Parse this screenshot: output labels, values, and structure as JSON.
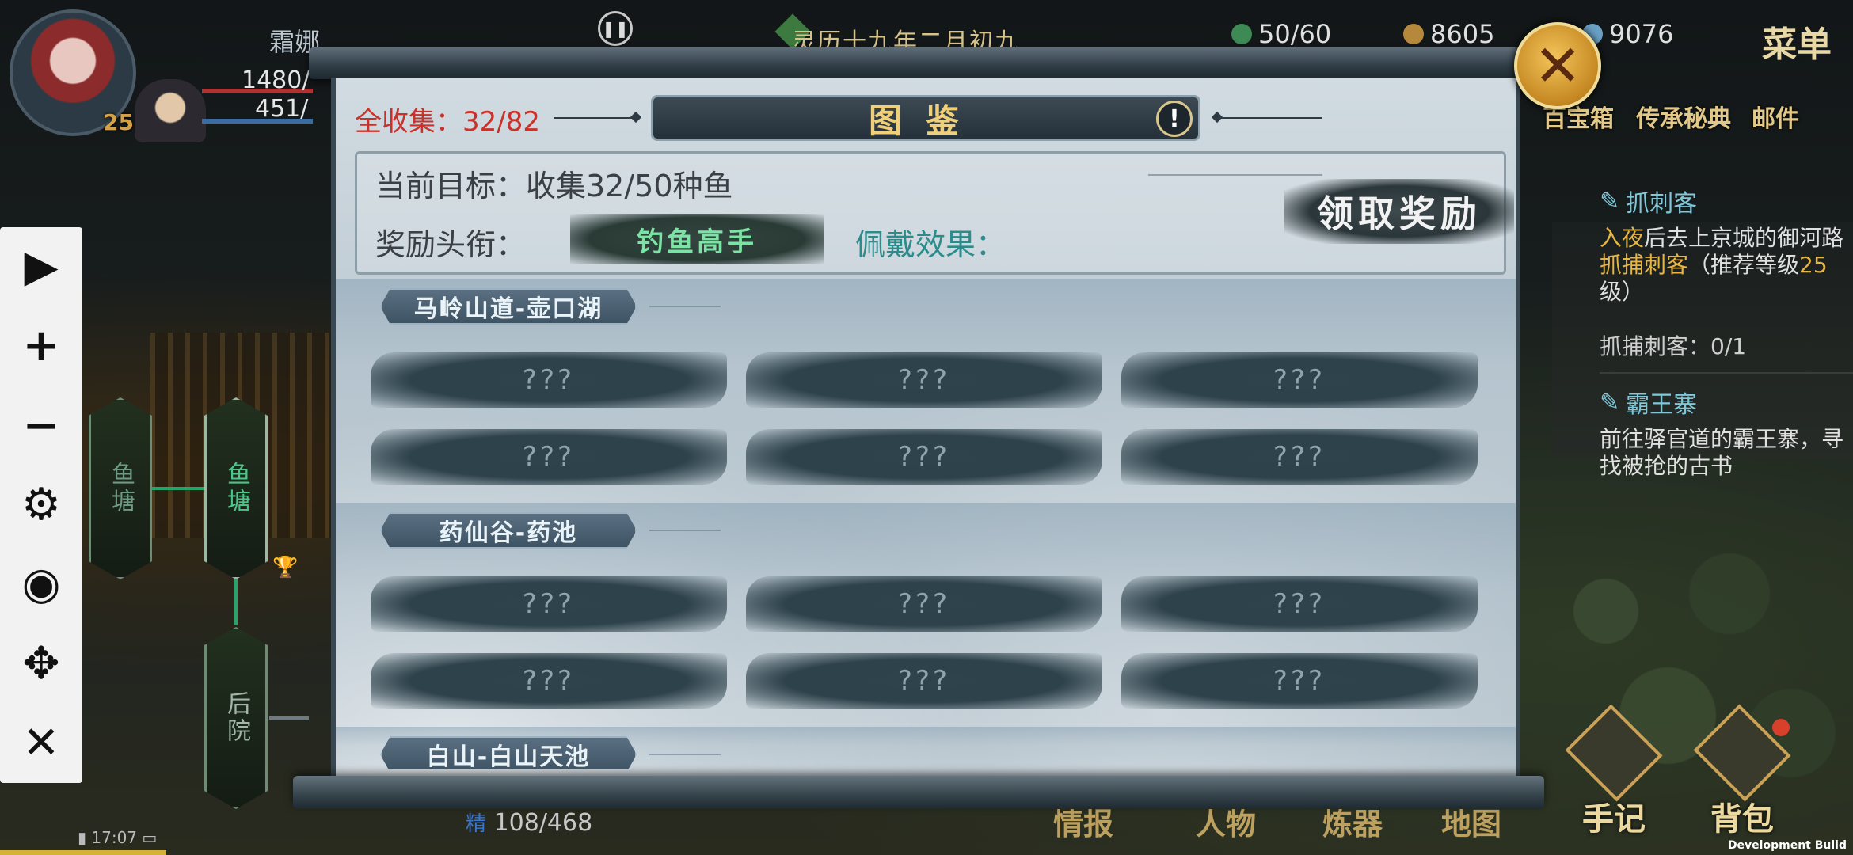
{
  "hud": {
    "hero_name": "霜娜",
    "level": "25",
    "hp": "1480/",
    "mp": "451/",
    "date": "灵历十九年二月初九",
    "copper": "50/60",
    "gold": "8605",
    "silver": "9076",
    "menu_label": "菜单"
  },
  "top_icons": [
    "百宝箱",
    "传承秘典",
    "邮件"
  ],
  "quests": [
    {
      "title": "抓刺客",
      "desc_highlight_1": "入夜",
      "desc_1": "后去上京城的御河路",
      "desc_highlight_2": "抓捕刺客",
      "desc_2": "（推荐等级",
      "desc_level": "25",
      "desc_3": "级）",
      "progress": "抓捕刺客：0/1"
    },
    {
      "title": "霸王寨",
      "desc": "前往驿官道的霸王寨，寻找被抢的古书"
    }
  ],
  "map_nodes": [
    "鱼塘",
    "鱼塘",
    "后院"
  ],
  "bottom": {
    "stamina_label": "精",
    "stamina": "108/468",
    "status_time": "17:07",
    "nav": [
      "情报",
      "人物",
      "炼器",
      "地图"
    ],
    "journal": "手记",
    "bag": "背包",
    "dev_build": "Development Build"
  },
  "codex": {
    "collect_all_label": "全收集：",
    "collect_all_value": "32/82",
    "title": "图鉴",
    "goal": "当前目标：收集32/50种鱼",
    "reward_title_label": "奖励头衔：",
    "reward_title": "钓鱼高手",
    "effect_label": "佩戴效果：",
    "claim_button": "领取奖励",
    "sections": [
      {
        "name": "马岭山道-壶口湖",
        "fish": [
          "???",
          "???",
          "???",
          "???",
          "???",
          "???"
        ]
      },
      {
        "name": "药仙谷-药池",
        "fish": [
          "???",
          "???",
          "???",
          "???",
          "???",
          "???"
        ]
      },
      {
        "name": "白山-白山天池",
        "fish": []
      }
    ]
  },
  "colors": {
    "accent_gold": "#f0cf7a",
    "collect_red": "#c9312a",
    "reward_green": "#7ce3a5",
    "effect_teal": "#2c8c8c",
    "quest_blue": "#7fc7d9"
  },
  "icons": [
    "pause-icon",
    "close-icon",
    "info-icon",
    "play-icon",
    "plus-icon",
    "minus-icon",
    "gear-icon",
    "eye-icon",
    "move-icon",
    "cross-icon"
  ]
}
